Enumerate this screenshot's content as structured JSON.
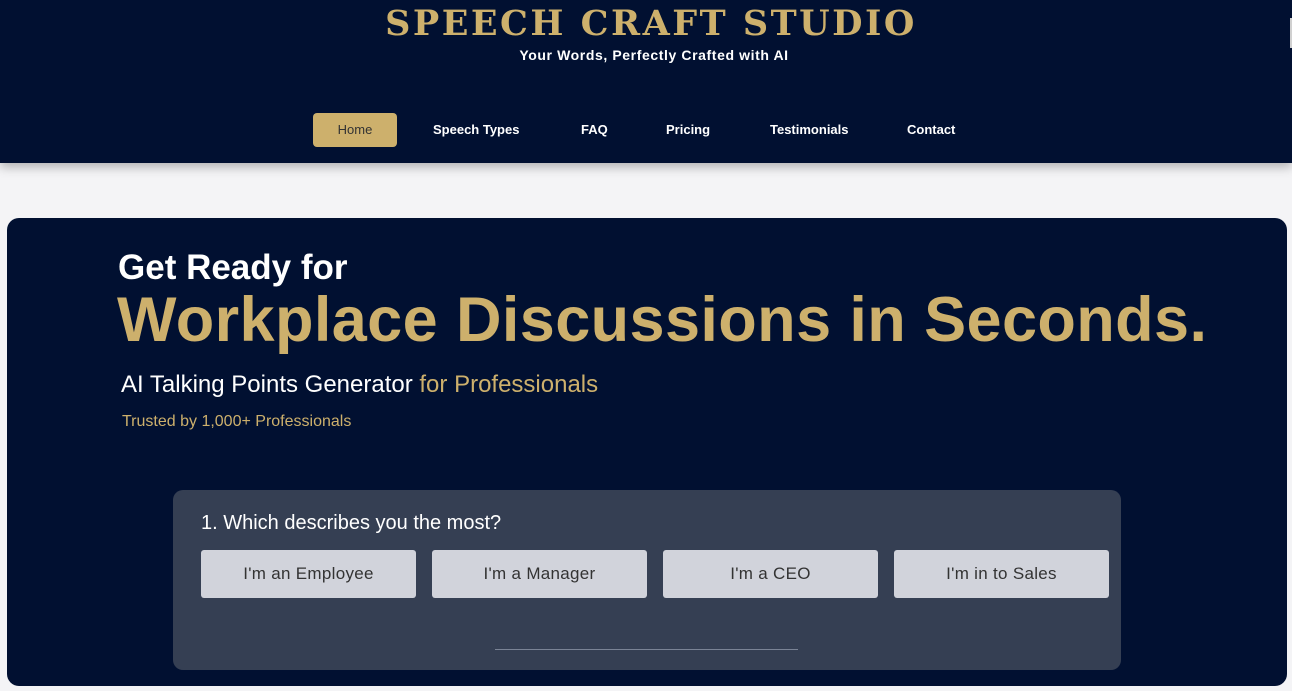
{
  "header": {
    "brand_title": "SPEECH CRAFT STUDIO",
    "tagline": "Your Words, Perfectly Crafted with AI"
  },
  "nav": {
    "items": [
      {
        "label": "Home",
        "active": true
      },
      {
        "label": "Speech Types",
        "active": false
      },
      {
        "label": "FAQ",
        "active": false
      },
      {
        "label": "Pricing",
        "active": false
      },
      {
        "label": "Testimonials",
        "active": false
      },
      {
        "label": "Contact",
        "active": false
      }
    ]
  },
  "hero": {
    "line1": "Get Ready for",
    "line2": "Workplace Discussions in Seconds.",
    "subtitle_main": "AI Talking Points Generator ",
    "subtitle_accent": "for Professionals",
    "trust_text": "Trusted by 1,000+ Professionals"
  },
  "quiz": {
    "question": "1. Which describes you the most?",
    "options": [
      {
        "label": "I'm an Employee"
      },
      {
        "label": "I'm a Manager"
      },
      {
        "label": "I'm a CEO"
      },
      {
        "label": "I'm in to Sales"
      }
    ]
  },
  "colors": {
    "navy": "#011031",
    "gold": "#cdb06c",
    "card": "#353f53",
    "option_bg": "#d1d3db",
    "page_bg": "#f4f4f6"
  }
}
